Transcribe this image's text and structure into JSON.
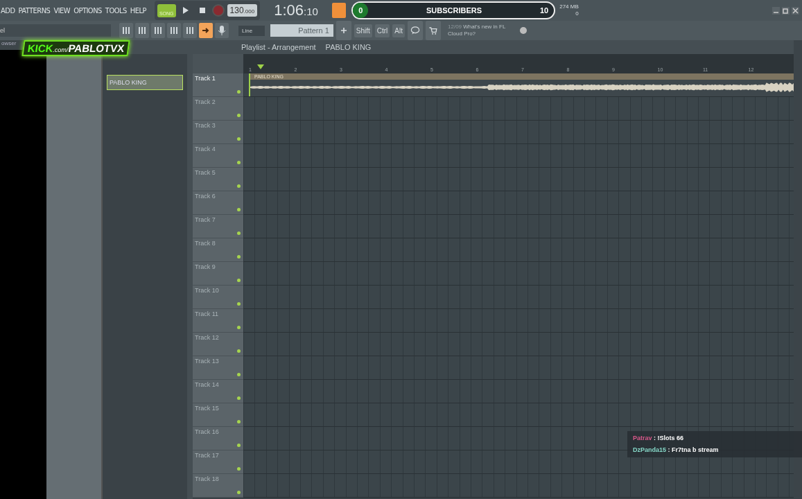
{
  "menu": [
    "ADD",
    "PATTERNS",
    "VIEW",
    "OPTIONS",
    "TOOLS",
    "HELP"
  ],
  "transport": {
    "mode": "SONG",
    "recording": false,
    "tempo": "130",
    "tempo_fraction": ".000",
    "time": "1:06",
    "time_ticks": ":10"
  },
  "subscribers": {
    "count": "0",
    "label": "SUBSCRIBERS",
    "goal": "10",
    "level": 0.0
  },
  "memory": {
    "used": "274 MB",
    "cpu": "0"
  },
  "snap": "Line",
  "pattern": "Pattern 1",
  "keys": [
    "Shift",
    "Ctrl",
    "Alt"
  ],
  "news": {
    "date": "12/09",
    "text": "What's new in FL Cloud Pro?"
  },
  "overlay_logo": {
    "brand": "KICK",
    ".com": ".com/",
    "channel": "PABLOTVX"
  },
  "browser": {
    "label": "owser",
    "field": "el"
  },
  "playlist": {
    "title": "Playlist - Arrangement",
    "pattern": "PABLO KING"
  },
  "clips": [
    {
      "name": "PABLO KING",
      "selected": true
    }
  ],
  "ruler": [
    "1",
    "2",
    "3",
    "4",
    "5",
    "6",
    "7",
    "8",
    "9",
    "10",
    "11",
    "12"
  ],
  "tracks": [
    {
      "name": "Track 1",
      "clip": "PABLO KING"
    },
    {
      "name": "Track 2"
    },
    {
      "name": "Track 3"
    },
    {
      "name": "Track 4"
    },
    {
      "name": "Track 5"
    },
    {
      "name": "Track 6"
    },
    {
      "name": "Track 7"
    },
    {
      "name": "Track 8"
    },
    {
      "name": "Track 9"
    },
    {
      "name": "Track 10"
    },
    {
      "name": "Track 11"
    },
    {
      "name": "Track 12"
    },
    {
      "name": "Track 13"
    },
    {
      "name": "Track 14"
    },
    {
      "name": "Track 15"
    },
    {
      "name": "Track 16"
    },
    {
      "name": "Track 17"
    },
    {
      "name": "Track 18"
    }
  ],
  "chat": [
    {
      "user": "Patrav",
      "color": "#d8588a",
      "separator": ":",
      "message": "!Slots 66"
    },
    {
      "user": "DzPanda15",
      "color": "#86d8c8",
      "separator": ":",
      "message": "Fr7tna b stream"
    }
  ]
}
